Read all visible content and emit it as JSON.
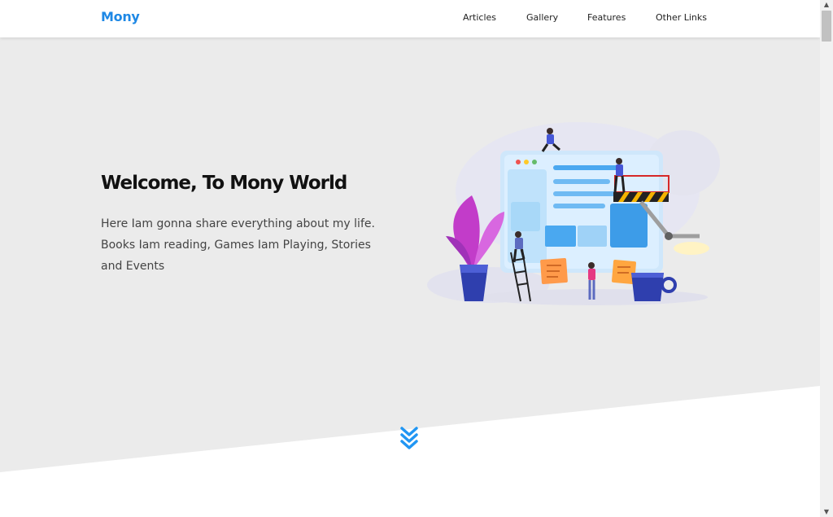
{
  "brand": {
    "logo": "Mony",
    "accent": "#1e88e5"
  },
  "nav": {
    "items": [
      {
        "label": "Articles"
      },
      {
        "label": "Gallery"
      },
      {
        "label": "Features"
      },
      {
        "label": "Other Links"
      }
    ]
  },
  "hero": {
    "title": "Welcome, To Mony World",
    "text": "Here Iam gonna share everything about my life. Books Iam reading, Games Iam Playing, Stories and Events",
    "background": "#ebebeb",
    "illustration_icon": "web-development-illustration"
  },
  "scroll_down": {
    "icon": "double-chevron-down-icon",
    "color": "#2196f3"
  }
}
